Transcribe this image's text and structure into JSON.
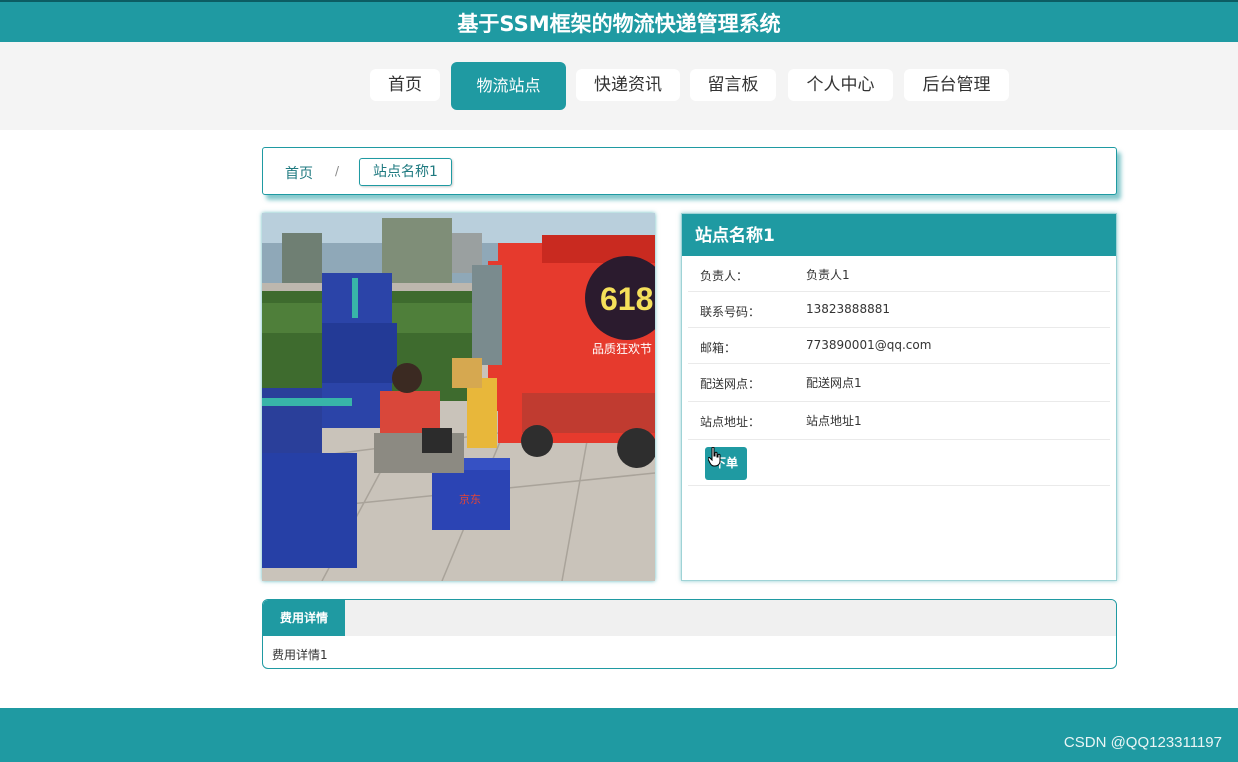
{
  "header": {
    "title": "基于SSM框架的物流快递管理系统"
  },
  "nav": {
    "items": [
      {
        "label": "首页"
      },
      {
        "label": "物流站点",
        "active": true
      },
      {
        "label": "快递资讯"
      },
      {
        "label": "留言板"
      },
      {
        "label": "个人中心"
      },
      {
        "label": "后台管理"
      }
    ]
  },
  "breadcrumb": {
    "home": "首页",
    "separator": "/",
    "current": "站点名称1"
  },
  "station": {
    "name": "站点名称1",
    "fields": [
      {
        "label": "负责人：",
        "value": "负责人1"
      },
      {
        "label": "联系号码：",
        "value": "13823888881"
      },
      {
        "label": "邮箱：",
        "value": "773890001@qq.com"
      },
      {
        "label": "配送网点：",
        "value": "配送网点1"
      },
      {
        "label": "站点地址：",
        "value": "站点地址1"
      }
    ],
    "order_button": "下单"
  },
  "photo": {
    "truck_text": "618",
    "truck_slogan": "品质狂欢节",
    "box_text": "京东"
  },
  "tabs": {
    "active_label": "费用详情",
    "content": "费用详情1"
  },
  "watermark": "CSDN @QQ123311197",
  "colors": {
    "accent": "#1f9aa2",
    "header_border": "#0c5d63",
    "nav_band": "#f4f4f4"
  }
}
